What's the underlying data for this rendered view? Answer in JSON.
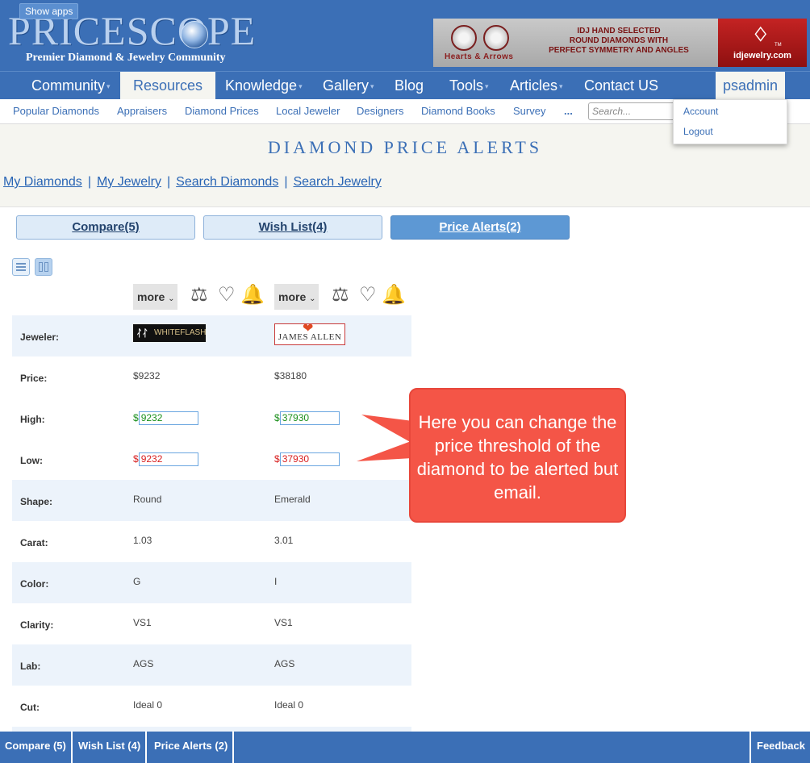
{
  "topbar": {
    "show_apps": "Show apps"
  },
  "logo": {
    "text": "PRICESCOPE",
    "tagline": "Premier Diamond & Jewelry Community"
  },
  "ad": {
    "brand_left": "Hearts & Arrows",
    "lines": [
      "IDJ HAND SELECTED",
      "ROUND DIAMONDS WITH",
      "PERFECT SYMMETRY AND ANGLES"
    ],
    "tm": "TM",
    "brand_right": "idjewelry.com"
  },
  "nav": {
    "items": [
      "Community",
      "Resources",
      "Knowledge",
      "Gallery",
      "Blog",
      "Tools",
      "Articles",
      "Contact US"
    ],
    "user": "psadmin"
  },
  "subnav": {
    "items": [
      "Popular Diamonds",
      "Appraisers",
      "Diamond Prices",
      "Local Jeweler",
      "Designers",
      "Diamond Books",
      "Survey",
      "..."
    ],
    "search_placeholder": "Search..."
  },
  "user_menu": {
    "items": [
      "Account",
      "Logout"
    ]
  },
  "page": {
    "title": "DIAMOND PRICE ALERTS",
    "links": [
      "My Diamonds",
      "My Jewelry",
      "Search Diamonds",
      "Search Jewelry"
    ]
  },
  "tabs": [
    "Compare(5)",
    "Wish List(4)",
    "Price Alerts(2)"
  ],
  "toolbar": {
    "more_label": "more"
  },
  "columns": [
    {
      "jeweler": "WHITEFLASH",
      "price": "$9232",
      "high_cur": "$",
      "high": "9232",
      "low_cur": "$",
      "low": "9232",
      "shape": "Round",
      "carat": "1.03",
      "color": "G",
      "clarity": "VS1",
      "lab": "AGS",
      "cut": "Ideal 0"
    },
    {
      "jeweler": "JAMES ALLEN",
      "price": "$38180",
      "high_cur": "$",
      "high": "37930",
      "low_cur": "$",
      "low": "37930",
      "shape": "Emerald",
      "carat": "3.01",
      "color": "I",
      "clarity": "VS1",
      "lab": "AGS",
      "cut": "Ideal 0"
    }
  ],
  "row_labels": {
    "jeweler": "Jeweler:",
    "price": "Price:",
    "high": "High:",
    "low": "Low:",
    "shape": "Shape:",
    "carat": "Carat:",
    "color": "Color:",
    "clarity": "Clarity:",
    "lab": "Lab:",
    "cut": "Cut:"
  },
  "callout": {
    "text": "Here you can change the price threshold of the diamond to be alerted but email."
  },
  "footer": {
    "items": [
      "Compare (5)",
      "Wish List (4)",
      "Price Alerts (2)"
    ],
    "feedback": "Feedback"
  },
  "colors": {
    "brand_blue": "#3b6fb6",
    "alert_high": "#1a8f1a",
    "alert_low": "#d82020",
    "callout": "#f45547",
    "bell": "#1e9a26"
  }
}
